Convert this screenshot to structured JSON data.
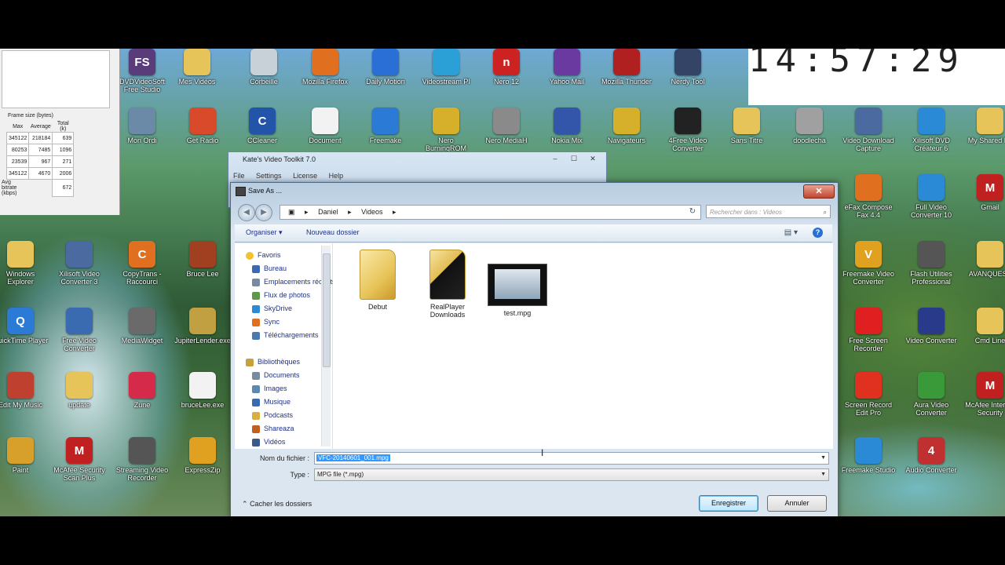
{
  "desktop": {
    "icons": [
      {
        "label": "DVDVideoSoft Free Studio",
        "glyph": "FS",
        "color": "#5a3c7a"
      },
      {
        "label": "Mes Vidéos",
        "glyph": "",
        "color": "#e6c45a"
      },
      {
        "label": "Corbeille",
        "glyph": "",
        "color": "#c8d0d8"
      },
      {
        "label": "Mozilla Firefox",
        "glyph": "",
        "color": "#e0701f"
      },
      {
        "label": "Daily Motion",
        "glyph": "",
        "color": "#2a6fd6"
      },
      {
        "label": "Videostream Pl",
        "glyph": "",
        "color": "#2aa0d6"
      },
      {
        "label": "Nero 12",
        "glyph": "n",
        "color": "#cc2222"
      },
      {
        "label": "Yahoo Mail",
        "glyph": "",
        "color": "#6a3aa0"
      },
      {
        "label": "Mozilla Thunder",
        "glyph": "",
        "color": "#b02020"
      },
      {
        "label": "Nerdy Tool",
        "glyph": "",
        "color": "#334466"
      },
      {
        "label": "Mon Ordi",
        "glyph": "",
        "color": "#6a8aa8"
      },
      {
        "label": "Get Radio",
        "glyph": "",
        "color": "#d84a2a"
      },
      {
        "label": "CCleaner",
        "glyph": "C",
        "color": "#2255aa"
      },
      {
        "label": "Document",
        "glyph": "",
        "color": "#f2f2f2"
      },
      {
        "label": "Freemake",
        "glyph": "",
        "color": "#2a7ad6"
      },
      {
        "label": "Nero BurningROM Nero Burnlite 12",
        "glyph": "",
        "color": "#d6b02a"
      },
      {
        "label": "Nero MediaH",
        "glyph": "",
        "color": "#8a8a8a"
      },
      {
        "label": "Nokia Mix",
        "glyph": "",
        "color": "#3355aa"
      },
      {
        "label": "Navigateurs",
        "glyph": "",
        "color": "#d6b02a"
      },
      {
        "label": "4Free Video Converter",
        "glyph": "",
        "color": "#222"
      },
      {
        "label": "Sans Titre",
        "glyph": "",
        "color": "#e6c45a"
      },
      {
        "label": "doodlecha",
        "glyph": "",
        "color": "#a0a0a0"
      },
      {
        "label": "Video Download Capture",
        "glyph": "",
        "color": "#4a6aa0"
      },
      {
        "label": "Xilisoft DVD Créateur 6",
        "glyph": "",
        "color": "#2a8ad6"
      },
      {
        "label": "My Shared Fo",
        "glyph": "",
        "color": "#e6c45a"
      },
      {
        "label": "Windows Explorer",
        "glyph": "",
        "color": "#e6c45a"
      },
      {
        "label": "Xilisoft Video Converter 3",
        "glyph": "",
        "color": "#4a6aa0"
      },
      {
        "label": "CopyTrans - Raccourci",
        "glyph": "C",
        "color": "#e07020"
      },
      {
        "label": "Bruce Lee",
        "glyph": "",
        "color": "#a04020"
      },
      {
        "label": "QuickTime Player",
        "glyph": "Q",
        "color": "#2a7ad6"
      },
      {
        "label": "Free Video Converter",
        "glyph": "",
        "color": "#3a6ab0"
      },
      {
        "label": "MediaWidget",
        "glyph": "",
        "color": "#6a6a6a"
      },
      {
        "label": "JupiterLender.exe",
        "glyph": "",
        "color": "#c0a040"
      },
      {
        "label": "Edit My Music",
        "glyph": "",
        "color": "#c04030"
      },
      {
        "label": "update",
        "glyph": "",
        "color": "#e6c45a"
      },
      {
        "label": "Zune",
        "glyph": "",
        "color": "#d62a4a"
      },
      {
        "label": "bruceLee.exe",
        "glyph": "",
        "color": "#f2f2f2"
      },
      {
        "label": "Paint",
        "glyph": "",
        "color": "#d6a02a"
      },
      {
        "label": "McAfee Security Scan Plus",
        "glyph": "M",
        "color": "#c02020"
      },
      {
        "label": "Streaming Video Recorder",
        "glyph": "",
        "color": "#555"
      },
      {
        "label": "ExpressZip",
        "glyph": "",
        "color": "#e0a020"
      },
      {
        "label": "eFax Compose Fax 4.4",
        "glyph": "",
        "color": "#e07020"
      },
      {
        "label": "Full Video Converter 10",
        "glyph": "",
        "color": "#2a8ad6"
      },
      {
        "label": "Gmail",
        "glyph": "M",
        "color": "#c02020"
      },
      {
        "label": "Freemake Video Converter",
        "glyph": "V",
        "color": "#e0a020"
      },
      {
        "label": "Flash Utilities Professional",
        "glyph": "",
        "color": "#555"
      },
      {
        "label": "AVANQUEST",
        "glyph": "",
        "color": "#e6c45a"
      },
      {
        "label": "Free Screen Recorder",
        "glyph": "",
        "color": "#e02020"
      },
      {
        "label": "Video Converter",
        "glyph": "",
        "color": "#2a3a8a"
      },
      {
        "label": "Cmd Line",
        "glyph": "",
        "color": "#e6c45a"
      },
      {
        "label": "Screen Record Edit Pro",
        "glyph": "",
        "color": "#e03020"
      },
      {
        "label": "Aura Video Converter",
        "glyph": "",
        "color": "#3a9a3a"
      },
      {
        "label": "McAfee Internet Security",
        "glyph": "M",
        "color": "#c02020"
      },
      {
        "label": "Freemake Studio",
        "glyph": "",
        "color": "#2a8ad6"
      },
      {
        "label": "Audio Converter",
        "glyph": "4",
        "color": "#c03030"
      }
    ]
  },
  "stats": {
    "header_line1": "Frame size (bytes)",
    "headers": [
      "Max",
      "Average",
      "Total (k)"
    ],
    "rows": [
      {
        "k": "",
        "v": [
          "345122",
          "218184",
          "639"
        ]
      },
      {
        "k": "",
        "v": [
          "80253",
          "7485",
          "1096"
        ]
      },
      {
        "k": "",
        "v": [
          "23539",
          "967",
          "271"
        ]
      },
      {
        "k": "",
        "v": [
          "345122",
          "4670",
          "2006"
        ]
      }
    ],
    "bitrate_label": "Avg bitrate (kbps)",
    "bitrate_value": "672"
  },
  "clock": {
    "time": "14:57:29"
  },
  "parent_window": {
    "title": "Kate's Video Toolkit 7.0",
    "menu": [
      "File",
      "Settings",
      "License",
      "Help"
    ],
    "min": "–",
    "max": "☐",
    "close": "✕"
  },
  "dialog": {
    "title": "Save As ...",
    "close": "✕",
    "back": "◀",
    "forward": "▶",
    "address": [
      "Daniel",
      "Videos"
    ],
    "address_sep": "▸",
    "refresh": "↻",
    "search_placeholder": "Rechercher dans : Videos",
    "toolbar": {
      "organize": "Organiser ▾",
      "new_folder": "Nouveau dossier",
      "help": "?"
    },
    "nav": {
      "favorites": "Favoris",
      "fav_items": [
        "Bureau",
        "Emplacements récents",
        "Flux de photos",
        "SkyDrive",
        "Sync",
        "Téléchargements"
      ],
      "libraries": "Bibliothèques",
      "lib_items": [
        "Documents",
        "Images",
        "Musique",
        "Podcasts",
        "Shareaza",
        "Vidéos"
      ]
    },
    "files": [
      {
        "name": "Debut",
        "type": "folder"
      },
      {
        "name": "RealPlayer Downloads",
        "type": "folder-dark"
      },
      {
        "name": "test.mpg",
        "type": "video"
      }
    ],
    "filename_label": "Nom du fichier :",
    "filename_value": "VFC-20140601_001.mpg",
    "type_label": "Type :",
    "type_value": "MPG file (*.mpg)",
    "hide_folders": "Cacher les dossiers",
    "save": "Enregistrer",
    "cancel": "Annuler"
  },
  "cursor": "I"
}
